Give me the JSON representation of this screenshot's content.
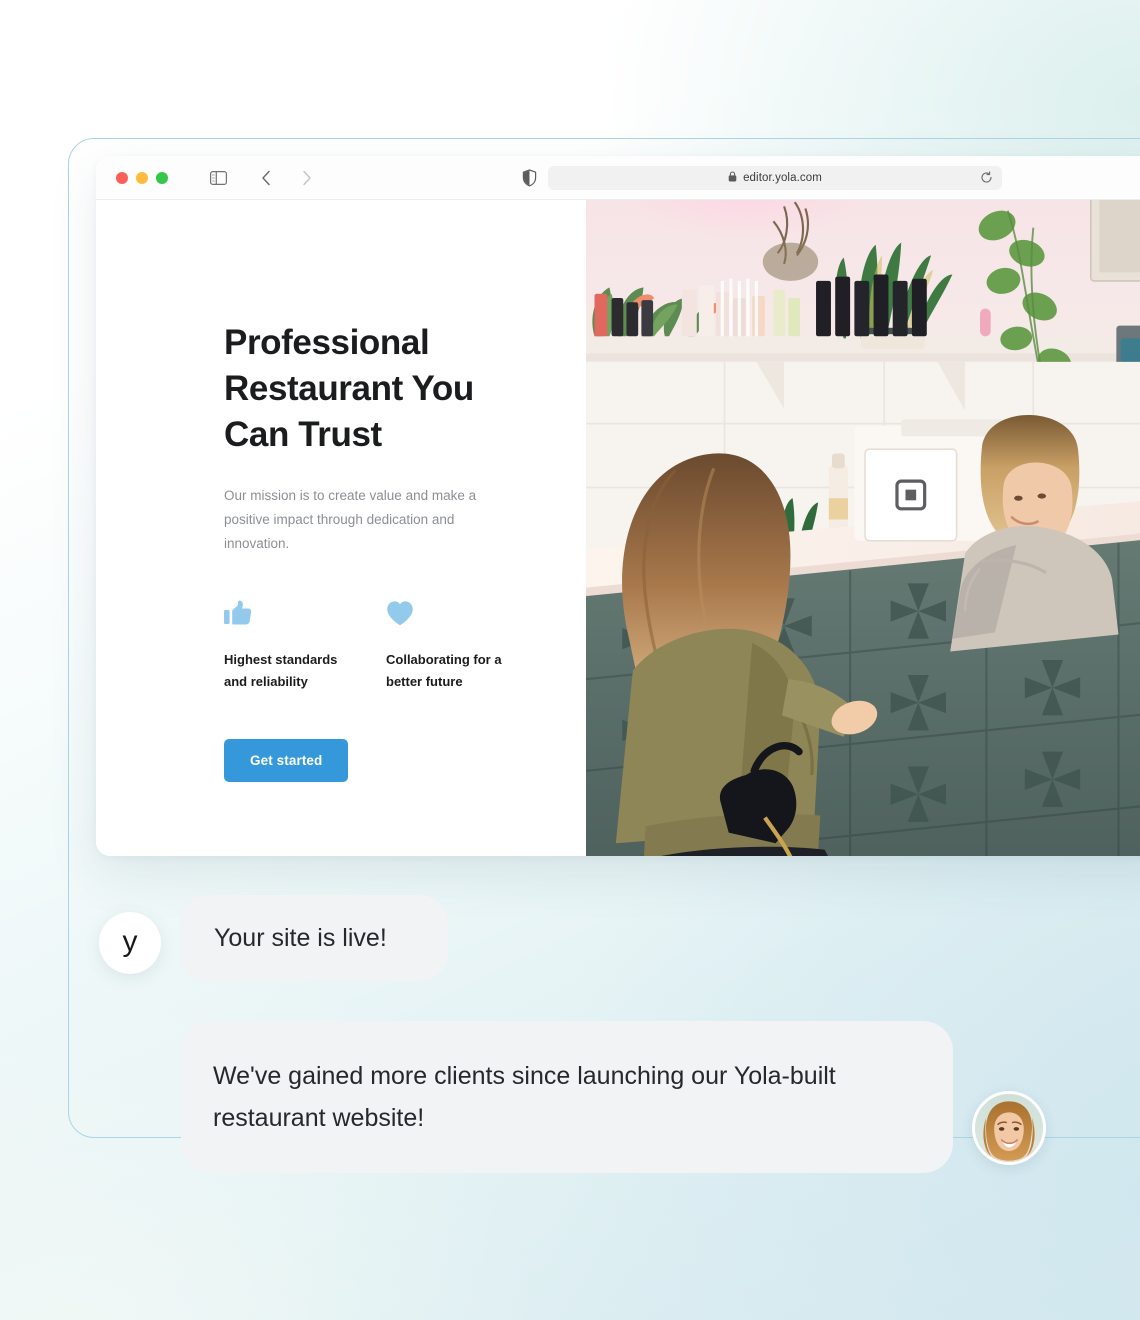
{
  "browser": {
    "traffic_lights": [
      {
        "name": "close",
        "color": "#fc6058"
      },
      {
        "name": "minimize",
        "color": "#fdbc40"
      },
      {
        "name": "maximize",
        "color": "#34c749"
      }
    ],
    "sidebar_toggle_label": "sidebar-toggle",
    "back_label": "back",
    "forward_label": "forward",
    "shield_label": "privacy-report",
    "url": "editor.yola.com",
    "lock_label": "secure",
    "reload_label": "reload"
  },
  "site": {
    "hero_title": "Professional Restaurant You Can Trust",
    "hero_subtitle": "Our mission is to create value and make a positive impact through dedication and innovation.",
    "features": [
      {
        "icon": "thumbs-up-icon",
        "label": "Highest standards and reliability"
      },
      {
        "icon": "heart-icon",
        "label": "Collaborating for a better future"
      }
    ],
    "cta_label": "Get started",
    "photo_alt": "Two women at a salon reception counter with plants and a POS terminal"
  },
  "chat": {
    "brand_initial": "y",
    "message_1": "Your site is live!",
    "message_2": "We've gained more clients since launching our Yola-built restaurant website!",
    "client_avatar_alt": "Smiling woman portrait"
  },
  "colors": {
    "accent_blue": "#3498db",
    "icon_blue": "#93c9ea",
    "bubble_bg": "#f1f3f4",
    "frame_border": "#a9d5e6",
    "text_dark": "#1b1c1e",
    "text_muted": "#8b8f94"
  }
}
